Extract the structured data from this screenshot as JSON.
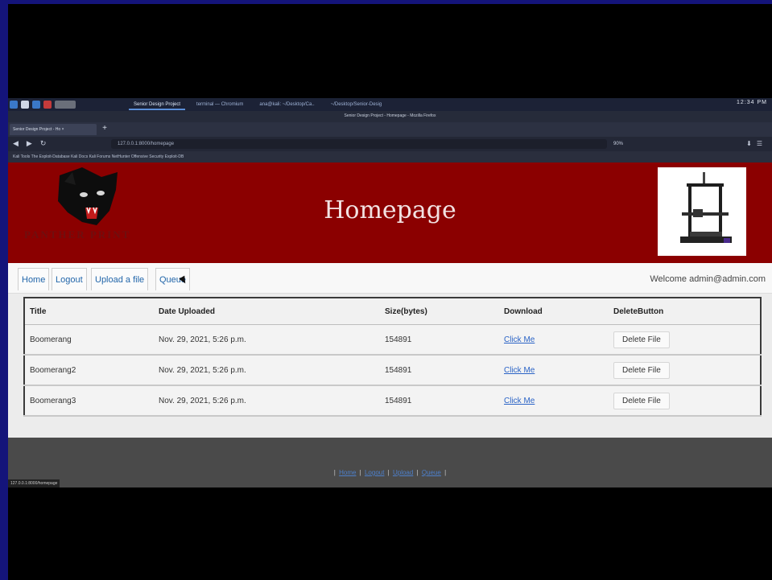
{
  "browser": {
    "taskbar_windows": [
      "Senior Design Project",
      "terminal — Chromium",
      "ana@kali: ~/Desktop/Ca..",
      "~/Desktop/Senior-Desig"
    ],
    "taskbar_right": "12:34 PM",
    "window_title": "Senior Design Project - Homepage - Mozilla Firefox",
    "tab_label": "Senior Design Project - Ho ×",
    "url": "127.0.0.1:8000/homepage",
    "zoom": "90%",
    "bookmarks": "Kali Tools  The Exploit-Database  Kali Docs  Kali Forums  NetHunter  Offensive Security  Exploit-DB"
  },
  "banner": {
    "logo_text": "PANTHER PRINT",
    "title": "Homepage"
  },
  "nav": {
    "items": [
      "Home",
      "Logout",
      "Upload a file",
      "Queue"
    ],
    "welcome": "Welcome admin@admin.com"
  },
  "table": {
    "headers": [
      "Title",
      "Date Uploaded",
      "Size(bytes)",
      "Download",
      "DeleteButton"
    ],
    "rows": [
      {
        "title": "Boomerang",
        "date": "Nov. 29, 2021, 5:26 p.m.",
        "size": "154891",
        "download": "Click Me",
        "delete": "Delete File"
      },
      {
        "title": "Boomerang2",
        "date": "Nov. 29, 2021, 5:26 p.m.",
        "size": "154891",
        "download": "Click Me",
        "delete": "Delete File"
      },
      {
        "title": "Boomerang3",
        "date": "Nov. 29, 2021, 5:26 p.m.",
        "size": "154891",
        "download": "Click Me",
        "delete": "Delete File"
      }
    ]
  },
  "footer": {
    "links": [
      "Home",
      "Logout",
      "Upload",
      "Queue"
    ],
    "status_url": "127.0.0.1:8000/homepage"
  }
}
